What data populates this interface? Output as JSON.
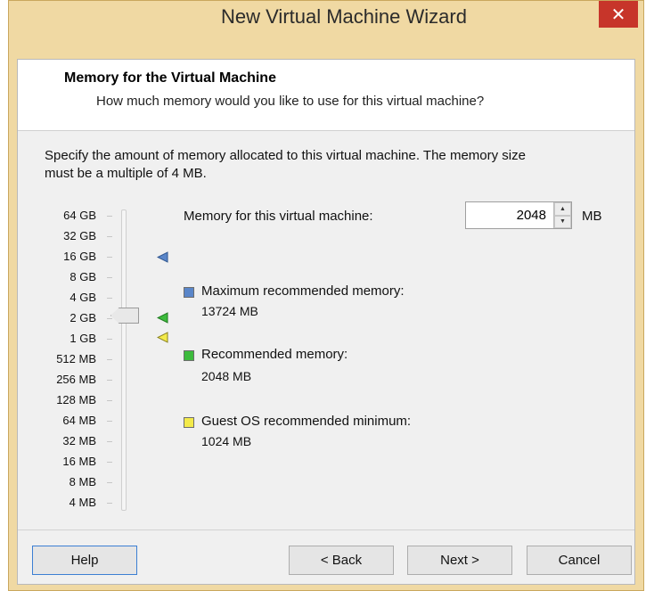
{
  "window": {
    "title": "New Virtual Machine Wizard",
    "close_symbol": "✕"
  },
  "header": {
    "title": "Memory for the Virtual Machine",
    "subtitle": "How much memory would you like to use for this virtual machine?"
  },
  "description": {
    "line1": "Specify the amount of memory allocated to this virtual machine. The memory size",
    "line2": "must be a multiple of 4 MB."
  },
  "scale": {
    "labels": [
      "64 GB",
      "32 GB",
      "16 GB",
      "8 GB",
      "4 GB",
      "2 GB",
      "1 GB",
      "512 MB",
      "256 MB",
      "128 MB",
      "64 MB",
      "32 MB",
      "16 MB",
      "8 MB",
      "4 MB"
    ],
    "selected": "2 GB"
  },
  "memory": {
    "label": "Memory for this virtual machine:",
    "value": "2048",
    "unit": "MB"
  },
  "legend": {
    "maximum": {
      "label": "Maximum recommended memory:",
      "value": "13724 MB",
      "color": "#5a86c9"
    },
    "recommended": {
      "label": "Recommended memory:",
      "value": "2048 MB",
      "color": "#3dbb3d"
    },
    "minimum": {
      "label": "Guest OS recommended minimum:",
      "value": "1024 MB",
      "color": "#f3ea4a"
    }
  },
  "buttons": {
    "help": "Help",
    "back": "< Back",
    "next": "Next >",
    "cancel": "Cancel"
  }
}
